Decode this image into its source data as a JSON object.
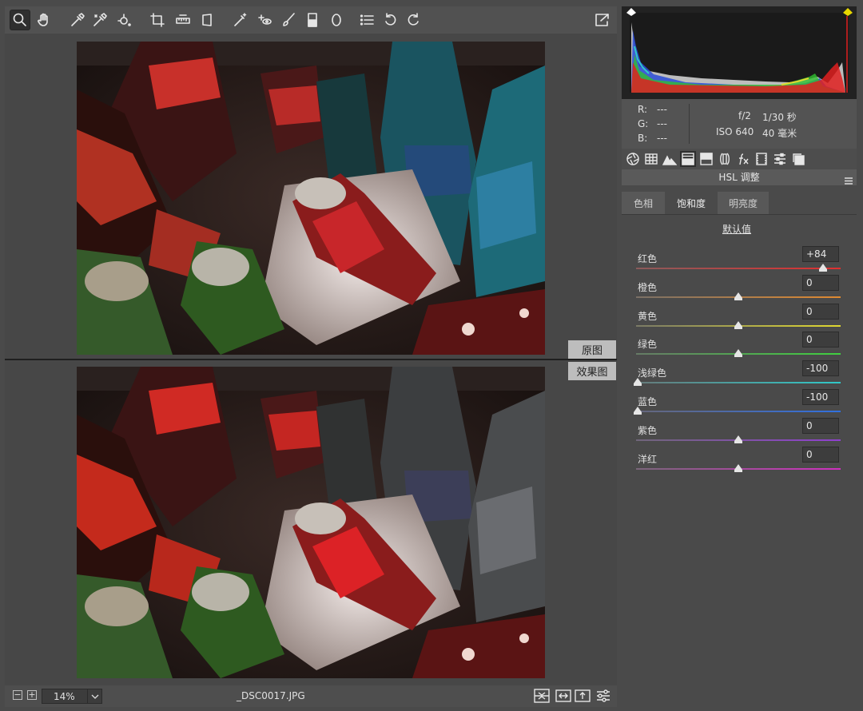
{
  "statusbar": {
    "zoom": "14%",
    "filename": "_DSC0017.JPG",
    "zoom_minus": "−",
    "zoom_plus": "+"
  },
  "compare": {
    "before_label": "原图",
    "after_label": "效果图"
  },
  "info": {
    "r_label": "R:",
    "r_value": "---",
    "g_label": "G:",
    "g_value": "---",
    "b_label": "B:",
    "b_value": "---",
    "aperture": "f/2",
    "shutter": "1/30 秒",
    "iso": "ISO 640",
    "focal": "40 毫米"
  },
  "panel": {
    "section_title": "HSL 调整",
    "subtabs": [
      "色相",
      "饱和度",
      "明亮度"
    ],
    "active_subtab": "饱和度",
    "default_link": "默认值",
    "sliders": [
      {
        "label": "红色",
        "value": "+84",
        "fraction": 0.92,
        "gradient": [
          "#8a5b5b",
          "#e03030"
        ]
      },
      {
        "label": "橙色",
        "value": "0",
        "fraction": 0.5,
        "gradient": [
          "#7a7066",
          "#e08a30"
        ]
      },
      {
        "label": "黄色",
        "value": "0",
        "fraction": 0.5,
        "gradient": [
          "#7a7a66",
          "#e0d830"
        ]
      },
      {
        "label": "绿色",
        "value": "0",
        "fraction": 0.5,
        "gradient": [
          "#667a66",
          "#40d040"
        ]
      },
      {
        "label": "浅绿色",
        "value": "-100",
        "fraction": 0.0,
        "gradient": [
          "#667a7a",
          "#30c8c8"
        ]
      },
      {
        "label": "蓝色",
        "value": "-100",
        "fraction": 0.0,
        "gradient": [
          "#66667a",
          "#3070e0"
        ]
      },
      {
        "label": "紫色",
        "value": "0",
        "fraction": 0.5,
        "gradient": [
          "#70667a",
          "#9040d0"
        ]
      },
      {
        "label": "洋红",
        "value": "0",
        "fraction": 0.5,
        "gradient": [
          "#7a667a",
          "#d030c0"
        ]
      }
    ]
  },
  "colors": {
    "accent": "#e6e6e6",
    "histogram_clip_highlight": "#e8d800"
  }
}
